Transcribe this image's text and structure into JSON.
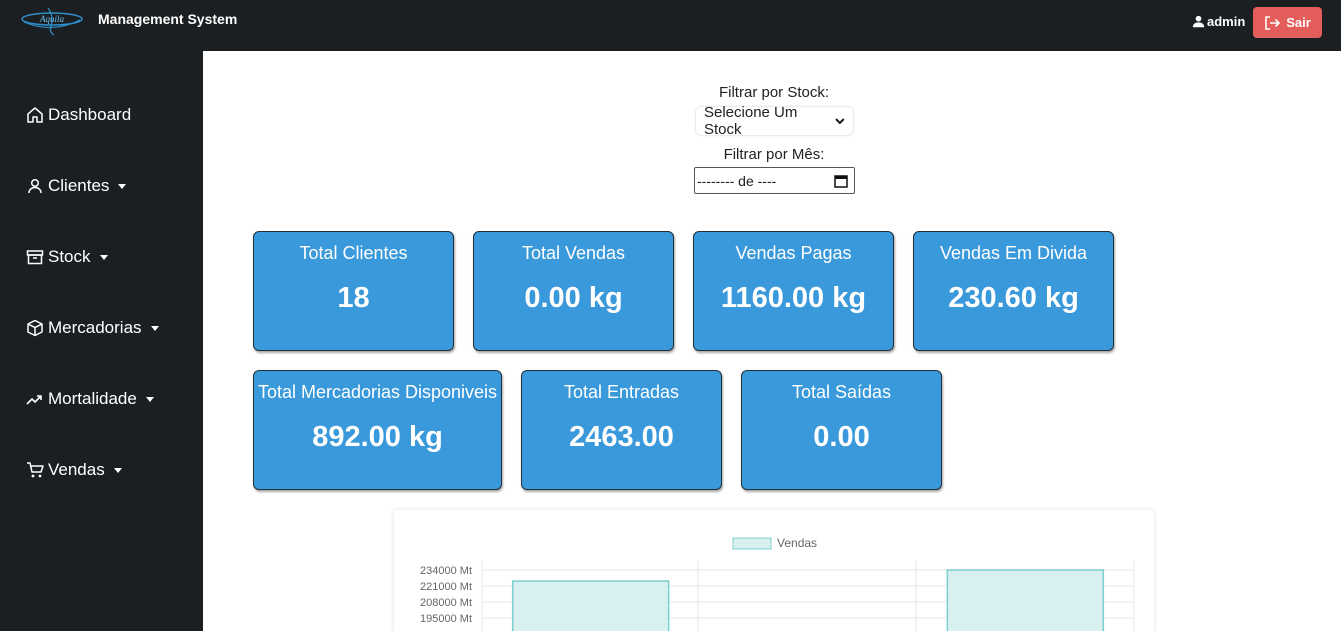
{
  "header": {
    "title": "Management System",
    "user": "admin",
    "logout_label": "Sair"
  },
  "sidebar": {
    "items": [
      {
        "label": "Dashboard",
        "icon": "home-icon",
        "has_dropdown": false
      },
      {
        "label": "Clientes",
        "icon": "user-icon",
        "has_dropdown": true
      },
      {
        "label": "Stock",
        "icon": "archive-box-icon",
        "has_dropdown": true
      },
      {
        "label": "Mercadorias",
        "icon": "package-icon",
        "has_dropdown": true
      },
      {
        "label": "Mortalidade",
        "icon": "trend-up-icon",
        "has_dropdown": true
      },
      {
        "label": "Vendas",
        "icon": "cart-icon",
        "has_dropdown": true
      }
    ]
  },
  "filters": {
    "stock_label": "Filtrar por Stock:",
    "stock_selected": "Selecione Um Stock",
    "month_label": "Filtrar por Mês:",
    "month_value": "-------- de ----"
  },
  "cards": [
    {
      "title": "Total Clientes",
      "value": "18"
    },
    {
      "title": "Total Vendas",
      "value": "0.00 kg"
    },
    {
      "title": "Vendas Pagas",
      "value": "1160.00 kg"
    },
    {
      "title": "Vendas Em Divida",
      "value": "230.60 kg"
    },
    {
      "title": "Total Mercadorias Disponiveis",
      "value": "892.00 kg"
    },
    {
      "title": "Total Entradas",
      "value": "2463.00"
    },
    {
      "title": "Total Saídas",
      "value": "0.00"
    }
  ],
  "colors": {
    "topbar": "#1b1f22",
    "card": "#3a99db",
    "logout": "#e35d5b",
    "bar_fill": "#d8f0f0",
    "bar_stroke": "#7ccfcf"
  },
  "chart_data": {
    "type": "bar",
    "legend": [
      "Vendas"
    ],
    "y_tick_labels": [
      "234000 Mt",
      "221000 Mt",
      "208000 Mt",
      "195000 Mt"
    ],
    "series": [
      {
        "name": "Vendas",
        "values": [
          225000,
          null,
          234000
        ]
      }
    ]
  }
}
